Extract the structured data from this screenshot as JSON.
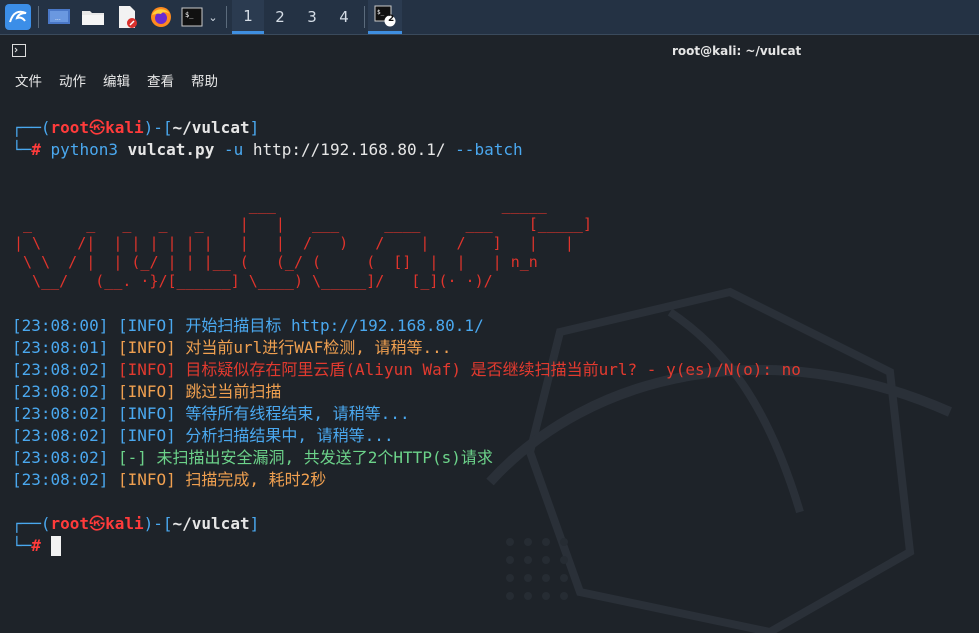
{
  "taskbar": {
    "icons": [
      "kali-menu-icon",
      "desktop-icon",
      "files-icon",
      "text-editor-icon",
      "firefox-icon",
      "terminal-icon"
    ],
    "workspaces": [
      "1",
      "2",
      "3",
      "4"
    ],
    "active_workspace": "1",
    "terminal_badge": "2"
  },
  "window": {
    "title": "root@kali: ~/vulcat"
  },
  "menu": [
    "文件",
    "动作",
    "编辑",
    "查看",
    "帮助"
  ],
  "prompt1": {
    "open": "┌──(",
    "user": "root",
    "at": "㉿",
    "host": "kali",
    "mid": ")-[",
    "path": "~/vulcat",
    "close": "]",
    "hash_prefix": "└─",
    "hash": "#",
    "cmd_prog": "python3",
    "cmd_script": "vulcat.py",
    "cmd_flag": "-u",
    "cmd_url": "http://192.168.80.1/",
    "cmd_batch": "--batch"
  },
  "ascii_art": [
    "                          ___                         _____",
    " _      _   _   _   _    |   |   ___     ____     ___    [_____]",
    "| \\    /|  | | | | | |   |   |  /   )   /    |   /   ]   |   |",
    " \\ \\  / |  | (_/ | | |__ (   (_/ (     (  []  |  |   | n_n",
    "  \\__/   (__. ·}/[______] \\____) \\_____]/   [_](· ·)/"
  ],
  "log": [
    {
      "time": "[23:08:00]",
      "level": "[INFO]",
      "msg": "开始扫描目标 http://192.168.80.1/",
      "color": "blue"
    },
    {
      "time": "[23:08:01]",
      "level": "[INFO]",
      "msg": "对当前url进行WAF检测, 请稍等...",
      "color": "orange"
    },
    {
      "time": "[23:08:02]",
      "level": "[INFO]",
      "msg": "目标疑似存在阿里云盾(Aliyun Waf) 是否继续扫描当前url? - y(es)/N(o): no",
      "color": "red"
    },
    {
      "time": "[23:08:02]",
      "level": "[INFO]",
      "msg": "跳过当前扫描",
      "color": "orange"
    },
    {
      "time": "[23:08:02]",
      "level": "[INFO]",
      "msg": "等待所有线程结束, 请稍等...",
      "color": "blue"
    },
    {
      "time": "[23:08:02]",
      "level": "[INFO]",
      "msg": "分析扫描结果中, 请稍等...",
      "color": "blue"
    },
    {
      "time": "[23:08:02]",
      "level": "[-]",
      "msg": "未扫描出安全漏洞, 共发送了2个HTTP(s)请求",
      "color": "green"
    },
    {
      "time": "[23:08:02]",
      "level": "[INFO]",
      "msg": "扫描完成, 耗时2秒",
      "color": "orange"
    }
  ],
  "colors": {
    "blue": "#4aa8ef",
    "orange": "#f0a050",
    "red": "#e23a2f",
    "green": "#6cd38a",
    "time": "#4aa8ef"
  }
}
